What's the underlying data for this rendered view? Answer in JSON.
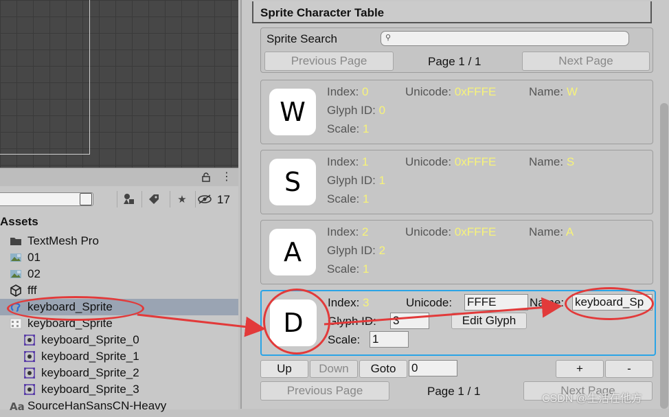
{
  "project": {
    "hidden_count": "17",
    "assets_label": "Assets",
    "tree": [
      {
        "label": "TextMesh Pro",
        "icon": "folder-icon",
        "indent": 1
      },
      {
        "label": "01",
        "icon": "image-icon",
        "indent": 1
      },
      {
        "label": "02",
        "icon": "image-icon",
        "indent": 1
      },
      {
        "label": "fff",
        "icon": "unity-prefab-icon",
        "indent": 1
      },
      {
        "label": "keyboard_Sprite",
        "icon": "sprite-asset-icon",
        "indent": 1,
        "selected": true
      },
      {
        "label": "keyboard_Sprite",
        "icon": "texture-icon",
        "indent": 1
      },
      {
        "label": "keyboard_Sprite_0",
        "icon": "sprite-icon",
        "indent": 2
      },
      {
        "label": "keyboard_Sprite_1",
        "icon": "sprite-icon",
        "indent": 2
      },
      {
        "label": "keyboard_Sprite_2",
        "icon": "sprite-icon",
        "indent": 2
      },
      {
        "label": "keyboard_Sprite_3",
        "icon": "sprite-icon",
        "indent": 2
      },
      {
        "label": "SourceHanSansCN-Heavy",
        "icon": "font-asset-icon",
        "indent": 1
      }
    ]
  },
  "inspector": {
    "title": "Sprite Character Table",
    "search_label": "Sprite Search",
    "prev_page": "Previous Page",
    "next_page": "Next Page",
    "page_indicator": "Page 1 / 1",
    "labels": {
      "index": "Index:",
      "unicode": "Unicode:",
      "name": "Name:",
      "glyph_id": "Glyph ID:",
      "scale": "Scale:"
    },
    "characters": [
      {
        "glyph": "W",
        "index": "0",
        "unicode": "0xFFFE",
        "name": "W",
        "glyph_id": "0",
        "scale": "1"
      },
      {
        "glyph": "S",
        "index": "1",
        "unicode": "0xFFFE",
        "name": "S",
        "glyph_id": "1",
        "scale": "1"
      },
      {
        "glyph": "A",
        "index": "2",
        "unicode": "0xFFFE",
        "name": "A",
        "glyph_id": "2",
        "scale": "1"
      }
    ],
    "selected": {
      "glyph": "D",
      "index": "3",
      "unicode": "FFFE",
      "name": "keyboard_Sp",
      "glyph_id": "3",
      "scale": "1",
      "edit_glyph": "Edit Glyph"
    },
    "controls": {
      "up": "Up",
      "down": "Down",
      "goto": "Goto",
      "goto_value": "0",
      "add": "+",
      "remove": "-"
    }
  },
  "watermark": "CSDN @生活在他方",
  "colors": {
    "value_text": "#f7f37a",
    "annotation": "#e23a3a",
    "selection_border": "#2aa4e6"
  }
}
